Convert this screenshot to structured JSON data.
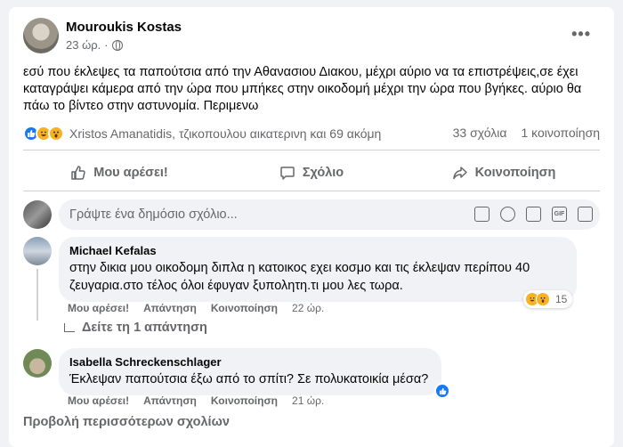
{
  "post": {
    "author": "Mouroukis Kostas",
    "time": "23 ώρ.",
    "separator": "·",
    "more_label": "•••",
    "text": "εσύ που έκλεψες τα παπούτσια από την Αθανασιου Διακου, μέχρι αύριο να τα επιστρέψεις,σε έχει καταγράψει κάμερα από την ώρα που μπήκες στην οικοδομή μέχρι την ώρα που βγήκες. αύριο θα πάω το βίντεο στην αστυνομία. Περιμενω",
    "reaction_icons": [
      "like-icon",
      "haha-icon",
      "wow-icon"
    ],
    "reaction_names": "Xristos Amanatidis, τζικοπουλου αικατερινη και 69 ακόμη",
    "comments_count": "33 σχόλια",
    "shares_count": "1 κοινοποίηση"
  },
  "actions": {
    "like": "Μου αρέσει!",
    "comment": "Σχόλιο",
    "share": "Κοινοποίηση"
  },
  "composer": {
    "placeholder": "Γράψτε ένα δημόσιο σχόλιο...",
    "gif_label": "GIF"
  },
  "comments": [
    {
      "author": "Michael Kefalas",
      "text": "στην δικια μου οικοδομη διπλα η κατοικος εχει κοσμο και τις έκλεψαν περίπου 40 ζευγαρια.στο τέλος όλοι έφυγαν ξυπολητη.τι μου λες τωρα.",
      "like": "Μου αρέσει!",
      "reply": "Απάντηση",
      "share": "Κοινοποίηση",
      "time": "22 ώρ.",
      "reaction_count": "15",
      "replies_label": "Δείτε τη 1 απάντηση"
    },
    {
      "author": "Isabella Schreckenschlager",
      "text": "Έκλεψαν παπούτσια έξω από το σπίτι? Σε πολυκατοικία μέσα?",
      "like": "Μου αρέσει!",
      "reply": "Απάντηση",
      "share": "Κοινοποίηση",
      "time": "21 ώρ."
    }
  ],
  "more_comments": "Προβολή περισσότερων σχολίων",
  "colors": {
    "like_blue": "#1877f2",
    "reaction_yellow": "#f7b125",
    "secondary_text": "#65676b",
    "bubble_bg": "#f0f2f5"
  }
}
